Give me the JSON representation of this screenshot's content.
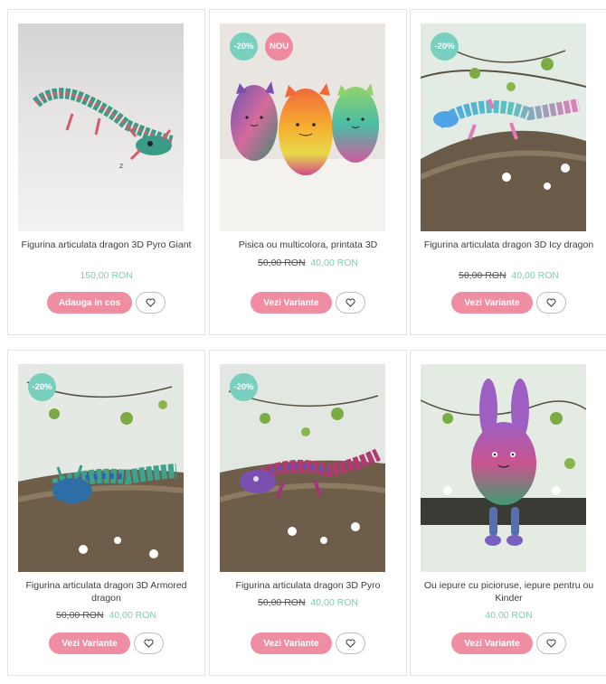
{
  "products": [
    {
      "title": "Figurina articulata dragon 3D Pyro Giant",
      "price_current": "150,00 RON",
      "price_old": "",
      "badges": [],
      "button_label": "Adauga in cos",
      "wishlist_icon": "heart-icon"
    },
    {
      "title": "Pisica ou multicolora, printata 3D",
      "price_current": "40,00 RON",
      "price_old": "50,00 RON",
      "badges": [
        "-20%",
        "NOU"
      ],
      "button_label": "Vezi Variante",
      "wishlist_icon": "heart-icon"
    },
    {
      "title": "Figurina articulata dragon 3D Icy dragon",
      "price_current": "40,00 RON",
      "price_old": "50,00 RON",
      "badges": [
        "-20%"
      ],
      "button_label": "Vezi Variante",
      "wishlist_icon": "heart-icon"
    },
    {
      "title": "Figurina articulata dragon 3D Armored dragon",
      "price_current": "40,00 RON",
      "price_old": "50,00 RON",
      "badges": [
        "-20%"
      ],
      "button_label": "Vezi Variante",
      "wishlist_icon": "heart-icon"
    },
    {
      "title": "Figurina articulata dragon 3D Pyro",
      "price_current": "40,00 RON",
      "price_old": "50,00 RON",
      "badges": [
        "-20%"
      ],
      "button_label": "Vezi Variante",
      "wishlist_icon": "heart-icon"
    },
    {
      "title": "Ou iepure cu picioruse, iepure pentru ou Kinder",
      "price_current": "40,00 RON",
      "price_old": "",
      "badges": [],
      "button_label": "Vezi Variante",
      "wishlist_icon": "heart-icon"
    }
  ],
  "colors": {
    "accent_pink": "#ef8ea2",
    "discount_badge": "#79d0be",
    "new_badge": "#ee8aa0",
    "price_green": "#7ccdb8"
  }
}
